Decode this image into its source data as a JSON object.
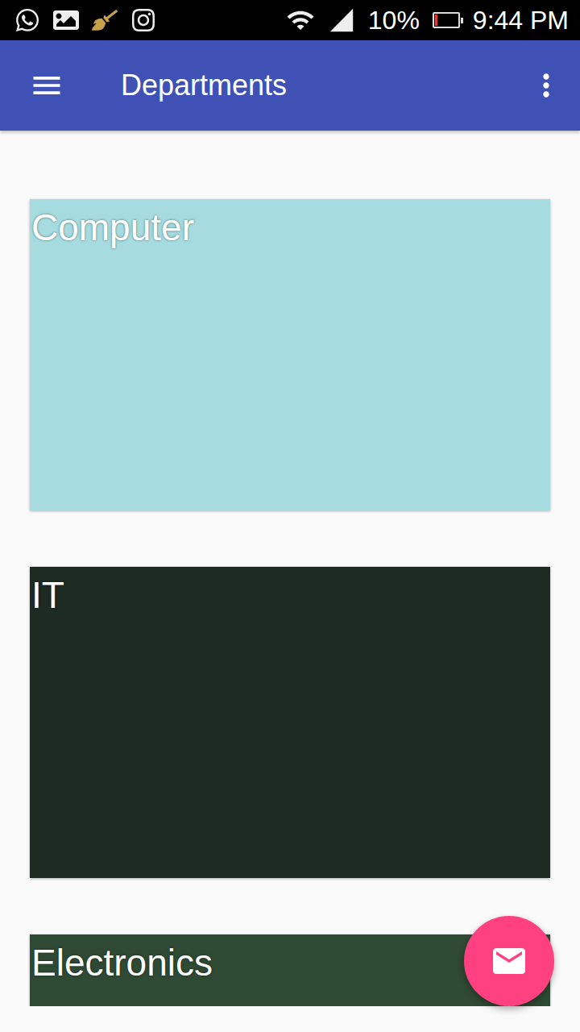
{
  "status_bar": {
    "battery": {
      "level": 0.1,
      "reading": "10%"
    },
    "time": "9:44 PM"
  },
  "app_bar": {
    "title": "Departments"
  },
  "departments": [
    {
      "name": "Computer",
      "color": "#a6dce0"
    },
    {
      "name": "IT",
      "color": "#1d2b22"
    },
    {
      "name": "Electronics",
      "color": "#2f4a34"
    }
  ]
}
